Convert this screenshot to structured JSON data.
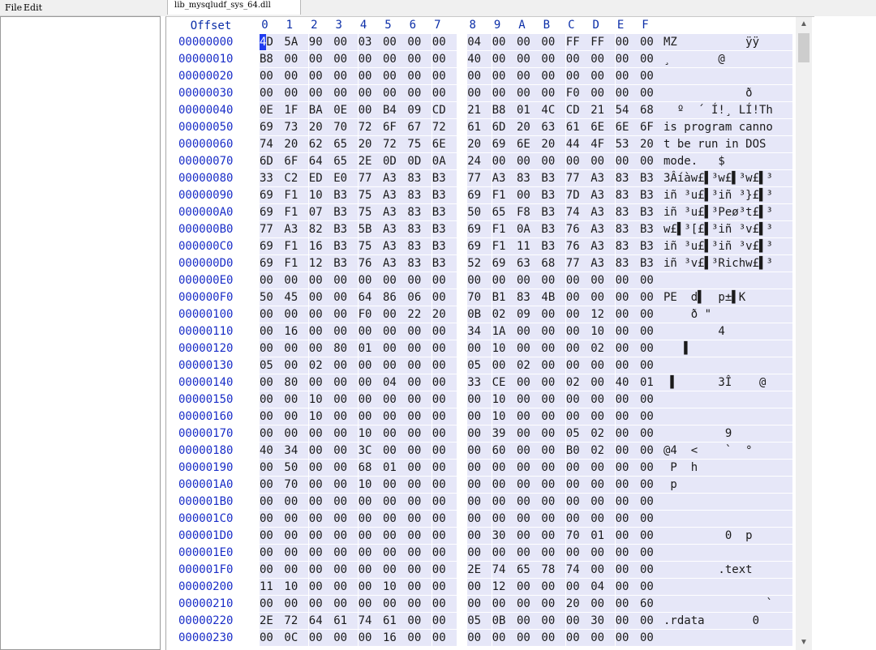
{
  "menu": {
    "file": "File",
    "edit": "Edit"
  },
  "tab": {
    "title": "lib_mysqludf_sys_64.dll"
  },
  "hex_header": {
    "offset_label": "Offset",
    "columns": [
      "0",
      "1",
      "2",
      "3",
      "4",
      "5",
      "6",
      "7",
      "8",
      "9",
      "A",
      "B",
      "C",
      "D",
      "E",
      "F"
    ]
  },
  "cursor": {
    "row": 0,
    "col": 0
  },
  "rows": [
    {
      "offset": "00000000",
      "bytes": [
        "4D",
        "5A",
        "90",
        "00",
        "03",
        "00",
        "00",
        "00",
        "04",
        "00",
        "00",
        "00",
        "FF",
        "FF",
        "00",
        "00"
      ],
      "ascii": "MZ          ÿÿ  "
    },
    {
      "offset": "00000010",
      "bytes": [
        "B8",
        "00",
        "00",
        "00",
        "00",
        "00",
        "00",
        "00",
        "40",
        "00",
        "00",
        "00",
        "00",
        "00",
        "00",
        "00"
      ],
      "ascii": "¸       @       "
    },
    {
      "offset": "00000020",
      "bytes": [
        "00",
        "00",
        "00",
        "00",
        "00",
        "00",
        "00",
        "00",
        "00",
        "00",
        "00",
        "00",
        "00",
        "00",
        "00",
        "00"
      ],
      "ascii": "                "
    },
    {
      "offset": "00000030",
      "bytes": [
        "00",
        "00",
        "00",
        "00",
        "00",
        "00",
        "00",
        "00",
        "00",
        "00",
        "00",
        "00",
        "F0",
        "00",
        "00",
        "00"
      ],
      "ascii": "            ð   "
    },
    {
      "offset": "00000040",
      "bytes": [
        "0E",
        "1F",
        "BA",
        "0E",
        "00",
        "B4",
        "09",
        "CD",
        "21",
        "B8",
        "01",
        "4C",
        "CD",
        "21",
        "54",
        "68"
      ],
      "ascii": "  º  ´ Í!¸ LÍ!Th"
    },
    {
      "offset": "00000050",
      "bytes": [
        "69",
        "73",
        "20",
        "70",
        "72",
        "6F",
        "67",
        "72",
        "61",
        "6D",
        "20",
        "63",
        "61",
        "6E",
        "6E",
        "6F"
      ],
      "ascii": "is program canno"
    },
    {
      "offset": "00000060",
      "bytes": [
        "74",
        "20",
        "62",
        "65",
        "20",
        "72",
        "75",
        "6E",
        "20",
        "69",
        "6E",
        "20",
        "44",
        "4F",
        "53",
        "20"
      ],
      "ascii": "t be run in DOS "
    },
    {
      "offset": "00000070",
      "bytes": [
        "6D",
        "6F",
        "64",
        "65",
        "2E",
        "0D",
        "0D",
        "0A",
        "24",
        "00",
        "00",
        "00",
        "00",
        "00",
        "00",
        "00"
      ],
      "ascii": "mode.   $       "
    },
    {
      "offset": "00000080",
      "bytes": [
        "33",
        "C2",
        "ED",
        "E0",
        "77",
        "A3",
        "83",
        "B3",
        "77",
        "A3",
        "83",
        "B3",
        "77",
        "A3",
        "83",
        "B3"
      ],
      "ascii": "3Âíàw£▌³w£▌³w£▌³"
    },
    {
      "offset": "00000090",
      "bytes": [
        "69",
        "F1",
        "10",
        "B3",
        "75",
        "A3",
        "83",
        "B3",
        "69",
        "F1",
        "00",
        "B3",
        "7D",
        "A3",
        "83",
        "B3"
      ],
      "ascii": "iñ ³u£▌³iñ ³}£▌³"
    },
    {
      "offset": "000000A0",
      "bytes": [
        "69",
        "F1",
        "07",
        "B3",
        "75",
        "A3",
        "83",
        "B3",
        "50",
        "65",
        "F8",
        "B3",
        "74",
        "A3",
        "83",
        "B3"
      ],
      "ascii": "iñ ³u£▌³Peø³t£▌³"
    },
    {
      "offset": "000000B0",
      "bytes": [
        "77",
        "A3",
        "82",
        "B3",
        "5B",
        "A3",
        "83",
        "B3",
        "69",
        "F1",
        "0A",
        "B3",
        "76",
        "A3",
        "83",
        "B3"
      ],
      "ascii": "w£▌³[£▌³iñ ³v£▌³"
    },
    {
      "offset": "000000C0",
      "bytes": [
        "69",
        "F1",
        "16",
        "B3",
        "75",
        "A3",
        "83",
        "B3",
        "69",
        "F1",
        "11",
        "B3",
        "76",
        "A3",
        "83",
        "B3"
      ],
      "ascii": "iñ ³u£▌³iñ ³v£▌³"
    },
    {
      "offset": "000000D0",
      "bytes": [
        "69",
        "F1",
        "12",
        "B3",
        "76",
        "A3",
        "83",
        "B3",
        "52",
        "69",
        "63",
        "68",
        "77",
        "A3",
        "83",
        "B3"
      ],
      "ascii": "iñ ³v£▌³Richw£▌³"
    },
    {
      "offset": "000000E0",
      "bytes": [
        "00",
        "00",
        "00",
        "00",
        "00",
        "00",
        "00",
        "00",
        "00",
        "00",
        "00",
        "00",
        "00",
        "00",
        "00",
        "00"
      ],
      "ascii": "                "
    },
    {
      "offset": "000000F0",
      "bytes": [
        "50",
        "45",
        "00",
        "00",
        "64",
        "86",
        "06",
        "00",
        "70",
        "B1",
        "83",
        "4B",
        "00",
        "00",
        "00",
        "00"
      ],
      "ascii": "PE  d▌  p±▌K    "
    },
    {
      "offset": "00000100",
      "bytes": [
        "00",
        "00",
        "00",
        "00",
        "F0",
        "00",
        "22",
        "20",
        "0B",
        "02",
        "09",
        "00",
        "00",
        "12",
        "00",
        "00"
      ],
      "ascii": "    ð \"         "
    },
    {
      "offset": "00000110",
      "bytes": [
        "00",
        "16",
        "00",
        "00",
        "00",
        "00",
        "00",
        "00",
        "34",
        "1A",
        "00",
        "00",
        "00",
        "10",
        "00",
        "00"
      ],
      "ascii": "        4       "
    },
    {
      "offset": "00000120",
      "bytes": [
        "00",
        "00",
        "00",
        "80",
        "01",
        "00",
        "00",
        "00",
        "00",
        "10",
        "00",
        "00",
        "00",
        "02",
        "00",
        "00"
      ],
      "ascii": "   ▌            "
    },
    {
      "offset": "00000130",
      "bytes": [
        "05",
        "00",
        "02",
        "00",
        "00",
        "00",
        "00",
        "00",
        "05",
        "00",
        "02",
        "00",
        "00",
        "00",
        "00",
        "00"
      ],
      "ascii": "                "
    },
    {
      "offset": "00000140",
      "bytes": [
        "00",
        "80",
        "00",
        "00",
        "00",
        "04",
        "00",
        "00",
        "33",
        "CE",
        "00",
        "00",
        "02",
        "00",
        "40",
        "01"
      ],
      "ascii": " ▌      3Î    @ "
    },
    {
      "offset": "00000150",
      "bytes": [
        "00",
        "00",
        "10",
        "00",
        "00",
        "00",
        "00",
        "00",
        "00",
        "10",
        "00",
        "00",
        "00",
        "00",
        "00",
        "00"
      ],
      "ascii": "                "
    },
    {
      "offset": "00000160",
      "bytes": [
        "00",
        "00",
        "10",
        "00",
        "00",
        "00",
        "00",
        "00",
        "00",
        "10",
        "00",
        "00",
        "00",
        "00",
        "00",
        "00"
      ],
      "ascii": "                "
    },
    {
      "offset": "00000170",
      "bytes": [
        "00",
        "00",
        "00",
        "00",
        "10",
        "00",
        "00",
        "00",
        "00",
        "39",
        "00",
        "00",
        "05",
        "02",
        "00",
        "00"
      ],
      "ascii": "         9      "
    },
    {
      "offset": "00000180",
      "bytes": [
        "40",
        "34",
        "00",
        "00",
        "3C",
        "00",
        "00",
        "00",
        "00",
        "60",
        "00",
        "00",
        "B0",
        "02",
        "00",
        "00"
      ],
      "ascii": "@4  <    `  °   "
    },
    {
      "offset": "00000190",
      "bytes": [
        "00",
        "50",
        "00",
        "00",
        "68",
        "01",
        "00",
        "00",
        "00",
        "00",
        "00",
        "00",
        "00",
        "00",
        "00",
        "00"
      ],
      "ascii": " P  h           "
    },
    {
      "offset": "000001A0",
      "bytes": [
        "00",
        "70",
        "00",
        "00",
        "10",
        "00",
        "00",
        "00",
        "00",
        "00",
        "00",
        "00",
        "00",
        "00",
        "00",
        "00"
      ],
      "ascii": " p              "
    },
    {
      "offset": "000001B0",
      "bytes": [
        "00",
        "00",
        "00",
        "00",
        "00",
        "00",
        "00",
        "00",
        "00",
        "00",
        "00",
        "00",
        "00",
        "00",
        "00",
        "00"
      ],
      "ascii": "                "
    },
    {
      "offset": "000001C0",
      "bytes": [
        "00",
        "00",
        "00",
        "00",
        "00",
        "00",
        "00",
        "00",
        "00",
        "00",
        "00",
        "00",
        "00",
        "00",
        "00",
        "00"
      ],
      "ascii": "                "
    },
    {
      "offset": "000001D0",
      "bytes": [
        "00",
        "00",
        "00",
        "00",
        "00",
        "00",
        "00",
        "00",
        "00",
        "30",
        "00",
        "00",
        "70",
        "01",
        "00",
        "00"
      ],
      "ascii": "         0  p   "
    },
    {
      "offset": "000001E0",
      "bytes": [
        "00",
        "00",
        "00",
        "00",
        "00",
        "00",
        "00",
        "00",
        "00",
        "00",
        "00",
        "00",
        "00",
        "00",
        "00",
        "00"
      ],
      "ascii": "                "
    },
    {
      "offset": "000001F0",
      "bytes": [
        "00",
        "00",
        "00",
        "00",
        "00",
        "00",
        "00",
        "00",
        "2E",
        "74",
        "65",
        "78",
        "74",
        "00",
        "00",
        "00"
      ],
      "ascii": "        .text   "
    },
    {
      "offset": "00000200",
      "bytes": [
        "11",
        "10",
        "00",
        "00",
        "00",
        "10",
        "00",
        "00",
        "00",
        "12",
        "00",
        "00",
        "00",
        "04",
        "00",
        "00"
      ],
      "ascii": "                "
    },
    {
      "offset": "00000210",
      "bytes": [
        "00",
        "00",
        "00",
        "00",
        "00",
        "00",
        "00",
        "00",
        "00",
        "00",
        "00",
        "00",
        "20",
        "00",
        "00",
        "60"
      ],
      "ascii": "               `"
    },
    {
      "offset": "00000220",
      "bytes": [
        "2E",
        "72",
        "64",
        "61",
        "74",
        "61",
        "00",
        "00",
        "05",
        "0B",
        "00",
        "00",
        "00",
        "30",
        "00",
        "00"
      ],
      "ascii": ".rdata       0  "
    },
    {
      "offset": "00000230",
      "bytes": [
        "00",
        "0C",
        "00",
        "00",
        "00",
        "16",
        "00",
        "00",
        "00",
        "00",
        "00",
        "00",
        "00",
        "00",
        "00",
        "00"
      ],
      "ascii": "                "
    }
  ],
  "icons": {
    "scroll_up": "chevron-up-icon",
    "scroll_down": "chevron-down-icon"
  },
  "colors": {
    "offset_text": "#1a2ec8",
    "header_text": "#0b2ea8",
    "cell_background": "#e6e7f8",
    "cursor": "#1f3cf0"
  }
}
